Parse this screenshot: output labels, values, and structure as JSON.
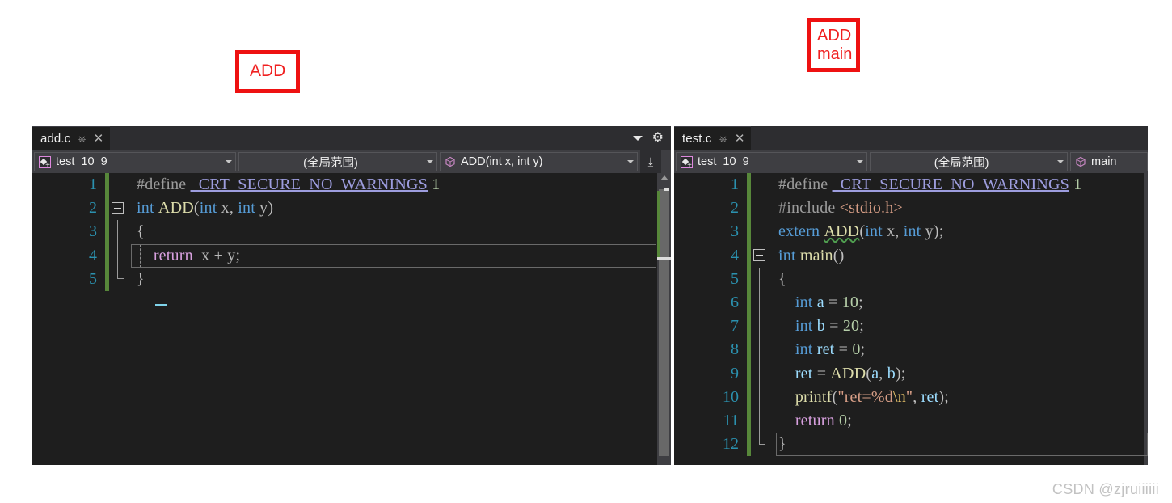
{
  "annotations": [
    {
      "id": "add",
      "lines": [
        "ADD"
      ],
      "color": "#ee1111"
    },
    {
      "id": "add-main",
      "lines": [
        "ADD",
        "main"
      ],
      "color": "#ee1111"
    }
  ],
  "watermark": "CSDN @zjruiiiiii",
  "left_pane": {
    "tab": {
      "title": "add.c",
      "pin_icon": "pin-icon",
      "close_icon": "close-icon"
    },
    "tabstrip_buttons": {
      "dropdown_icon": "chevron-down-icon",
      "settings_icon": "gear-icon"
    },
    "navbar": {
      "project": "test_10_9",
      "scope": "(全局范围)",
      "member": "ADD(int x, int y)",
      "splitter_label": "↕"
    },
    "line_numbers": [
      "1",
      "2",
      "3",
      "4",
      "5"
    ],
    "code_lines": [
      {
        "n": "1",
        "tokens": [
          {
            "t": "#define ",
            "c": "t-pre"
          },
          {
            "t": "_CRT_SECURE_NO_WARNINGS",
            "c": "t-macro"
          },
          {
            "t": " ",
            "c": "t-pre"
          },
          {
            "t": "1",
            "c": "t-num"
          }
        ]
      },
      {
        "n": "2",
        "tokens": [
          {
            "t": "int",
            "c": "t-kw"
          },
          {
            "t": " ",
            "c": "t-punct"
          },
          {
            "t": "ADD",
            "c": "t-fn"
          },
          {
            "t": "(",
            "c": "t-punct"
          },
          {
            "t": "int",
            "c": "t-kw"
          },
          {
            "t": " x, ",
            "c": "t-id"
          },
          {
            "t": "int",
            "c": "t-kw"
          },
          {
            "t": " y",
            "c": "t-id"
          },
          {
            "t": ")",
            "c": "t-punct"
          }
        ]
      },
      {
        "n": "3",
        "tokens": [
          {
            "t": "{",
            "c": "t-punct"
          }
        ]
      },
      {
        "n": "4",
        "tokens": [
          {
            "t": "    ",
            "c": "t-punct"
          },
          {
            "t": "return",
            "c": "t-ctl"
          },
          {
            "t": "  x + y;",
            "c": "t-id"
          }
        ]
      },
      {
        "n": "5",
        "tokens": [
          {
            "t": "}",
            "c": "t-punct"
          }
        ]
      }
    ]
  },
  "right_pane": {
    "tab": {
      "title": "test.c",
      "pin_icon": "pin-icon",
      "close_icon": "close-icon"
    },
    "navbar": {
      "project": "test_10_9",
      "scope": "(全局范围)",
      "member": "main"
    },
    "line_numbers": [
      "1",
      "2",
      "3",
      "4",
      "5",
      "6",
      "7",
      "8",
      "9",
      "10",
      "11",
      "12"
    ],
    "code_lines": [
      {
        "n": "1",
        "tokens": [
          {
            "t": "#define ",
            "c": "t-pre"
          },
          {
            "t": "_CRT_SECURE_NO_WARNINGS",
            "c": "t-macro"
          },
          {
            "t": " ",
            "c": "t-pre"
          },
          {
            "t": "1",
            "c": "t-num"
          }
        ]
      },
      {
        "n": "2",
        "tokens": [
          {
            "t": "#include ",
            "c": "t-pre"
          },
          {
            "t": "<stdio.h>",
            "c": "t-inc"
          }
        ]
      },
      {
        "n": "3",
        "tokens": [
          {
            "t": "extern",
            "c": "t-kw"
          },
          {
            "t": " ",
            "c": "t-punct"
          },
          {
            "t": "ADD",
            "c": "t-fn squiggle"
          },
          {
            "t": "(",
            "c": "t-punct"
          },
          {
            "t": "int",
            "c": "t-kw"
          },
          {
            "t": " x, ",
            "c": "t-id"
          },
          {
            "t": "int",
            "c": "t-kw"
          },
          {
            "t": " y",
            "c": "t-id"
          },
          {
            "t": ");",
            "c": "t-punct"
          }
        ]
      },
      {
        "n": "4",
        "tokens": [
          {
            "t": "int",
            "c": "t-kw"
          },
          {
            "t": " ",
            "c": "t-punct"
          },
          {
            "t": "main",
            "c": "t-fn"
          },
          {
            "t": "()",
            "c": "t-punct"
          }
        ]
      },
      {
        "n": "5",
        "tokens": [
          {
            "t": "{",
            "c": "t-punct"
          }
        ]
      },
      {
        "n": "6",
        "tokens": [
          {
            "t": "    ",
            "c": "t-punct"
          },
          {
            "t": "int",
            "c": "t-kw"
          },
          {
            "t": " ",
            "c": "t-punct"
          },
          {
            "t": "a",
            "c": "t-var"
          },
          {
            "t": " = ",
            "c": "t-punct"
          },
          {
            "t": "10",
            "c": "t-num"
          },
          {
            "t": ";",
            "c": "t-punct"
          }
        ]
      },
      {
        "n": "7",
        "tokens": [
          {
            "t": "    ",
            "c": "t-punct"
          },
          {
            "t": "int",
            "c": "t-kw"
          },
          {
            "t": " ",
            "c": "t-punct"
          },
          {
            "t": "b",
            "c": "t-var"
          },
          {
            "t": " = ",
            "c": "t-punct"
          },
          {
            "t": "20",
            "c": "t-num"
          },
          {
            "t": ";",
            "c": "t-punct"
          }
        ]
      },
      {
        "n": "8",
        "tokens": [
          {
            "t": "    ",
            "c": "t-punct"
          },
          {
            "t": "int",
            "c": "t-kw"
          },
          {
            "t": " ",
            "c": "t-punct"
          },
          {
            "t": "ret",
            "c": "t-var"
          },
          {
            "t": " = ",
            "c": "t-punct"
          },
          {
            "t": "0",
            "c": "t-num"
          },
          {
            "t": ";",
            "c": "t-punct"
          }
        ]
      },
      {
        "n": "9",
        "tokens": [
          {
            "t": "    ",
            "c": "t-punct"
          },
          {
            "t": "ret",
            "c": "t-var"
          },
          {
            "t": " = ",
            "c": "t-punct"
          },
          {
            "t": "ADD",
            "c": "t-fn"
          },
          {
            "t": "(",
            "c": "t-punct"
          },
          {
            "t": "a",
            "c": "t-var"
          },
          {
            "t": ", ",
            "c": "t-punct"
          },
          {
            "t": "b",
            "c": "t-var"
          },
          {
            "t": ");",
            "c": "t-punct"
          }
        ]
      },
      {
        "n": "10",
        "tokens": [
          {
            "t": "    ",
            "c": "t-punct"
          },
          {
            "t": "printf",
            "c": "t-fn"
          },
          {
            "t": "(",
            "c": "t-punct"
          },
          {
            "t": "\"ret=%d",
            "c": "t-str"
          },
          {
            "t": "\\n",
            "c": "t-esc"
          },
          {
            "t": "\"",
            "c": "t-str"
          },
          {
            "t": ", ",
            "c": "t-punct"
          },
          {
            "t": "ret",
            "c": "t-var"
          },
          {
            "t": ");",
            "c": "t-punct"
          }
        ]
      },
      {
        "n": "11",
        "tokens": [
          {
            "t": "    ",
            "c": "t-punct"
          },
          {
            "t": "return",
            "c": "t-ctl"
          },
          {
            "t": " ",
            "c": "t-punct"
          },
          {
            "t": "0",
            "c": "t-num"
          },
          {
            "t": ";",
            "c": "t-punct"
          }
        ]
      },
      {
        "n": "12",
        "tokens": [
          {
            "t": "}",
            "c": "t-punct"
          }
        ]
      }
    ]
  }
}
